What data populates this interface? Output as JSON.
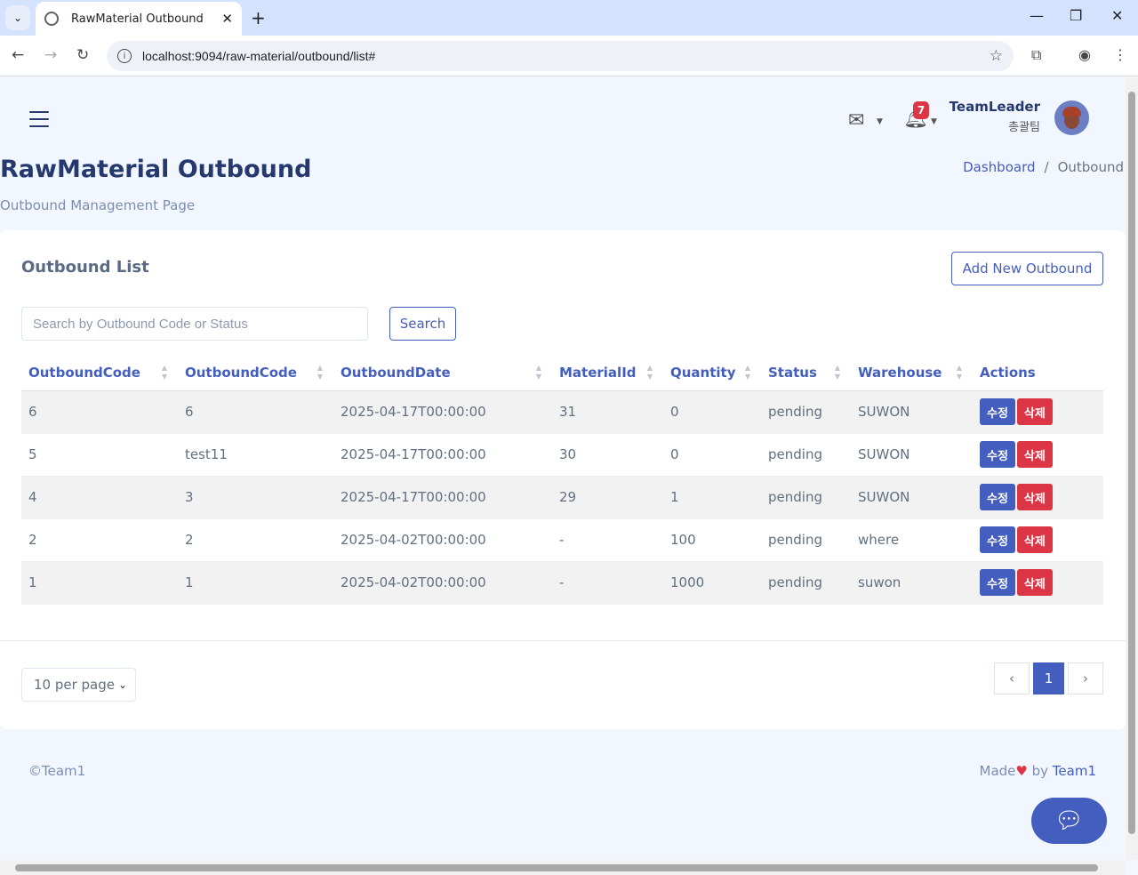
{
  "browser": {
    "tab_title": "RawMaterial Outbound",
    "url": "localhost:9094/raw-material/outbound/list#"
  },
  "header": {
    "notification_count": "7",
    "user_name": "TeamLeader",
    "user_role": "총괄팀"
  },
  "page": {
    "title": "RawMaterial Outbound",
    "subtitle": "Outbound Management Page",
    "breadcrumb": {
      "home": "Dashboard",
      "sep": "/",
      "current": "Outbound"
    }
  },
  "card": {
    "title": "Outbound List",
    "add_button": "Add New Outbound",
    "search_placeholder": "Search by Outbound Code or Status",
    "search_button": "Search"
  },
  "table": {
    "headers": [
      "OutboundCode",
      "OutboundCode",
      "OutboundDate",
      "MaterialId",
      "Quantity",
      "Status",
      "Warehouse",
      "Actions"
    ],
    "rows": [
      [
        "6",
        "6",
        "2025-04-17T00:00:00",
        "31",
        "0",
        "pending",
        "SUWON"
      ],
      [
        "5",
        "test11",
        "2025-04-17T00:00:00",
        "30",
        "0",
        "pending",
        "SUWON"
      ],
      [
        "4",
        "3",
        "2025-04-17T00:00:00",
        "29",
        "1",
        "pending",
        "SUWON"
      ],
      [
        "2",
        "2",
        "2025-04-02T00:00:00",
        "-",
        "100",
        "pending",
        "where"
      ],
      [
        "1",
        "1",
        "2025-04-02T00:00:00",
        "-",
        "1000",
        "pending",
        "suwon"
      ]
    ],
    "edit_label": "수정",
    "delete_label": "삭제"
  },
  "pagination": {
    "per_page": "10 per page",
    "current_page": "1"
  },
  "footer": {
    "copyright": "©Team1",
    "made": "Made",
    "by": " by ",
    "team": "Team1"
  },
  "colors": {
    "primary": "#435ebe",
    "danger": "#dc3545",
    "title": "#25396f"
  }
}
